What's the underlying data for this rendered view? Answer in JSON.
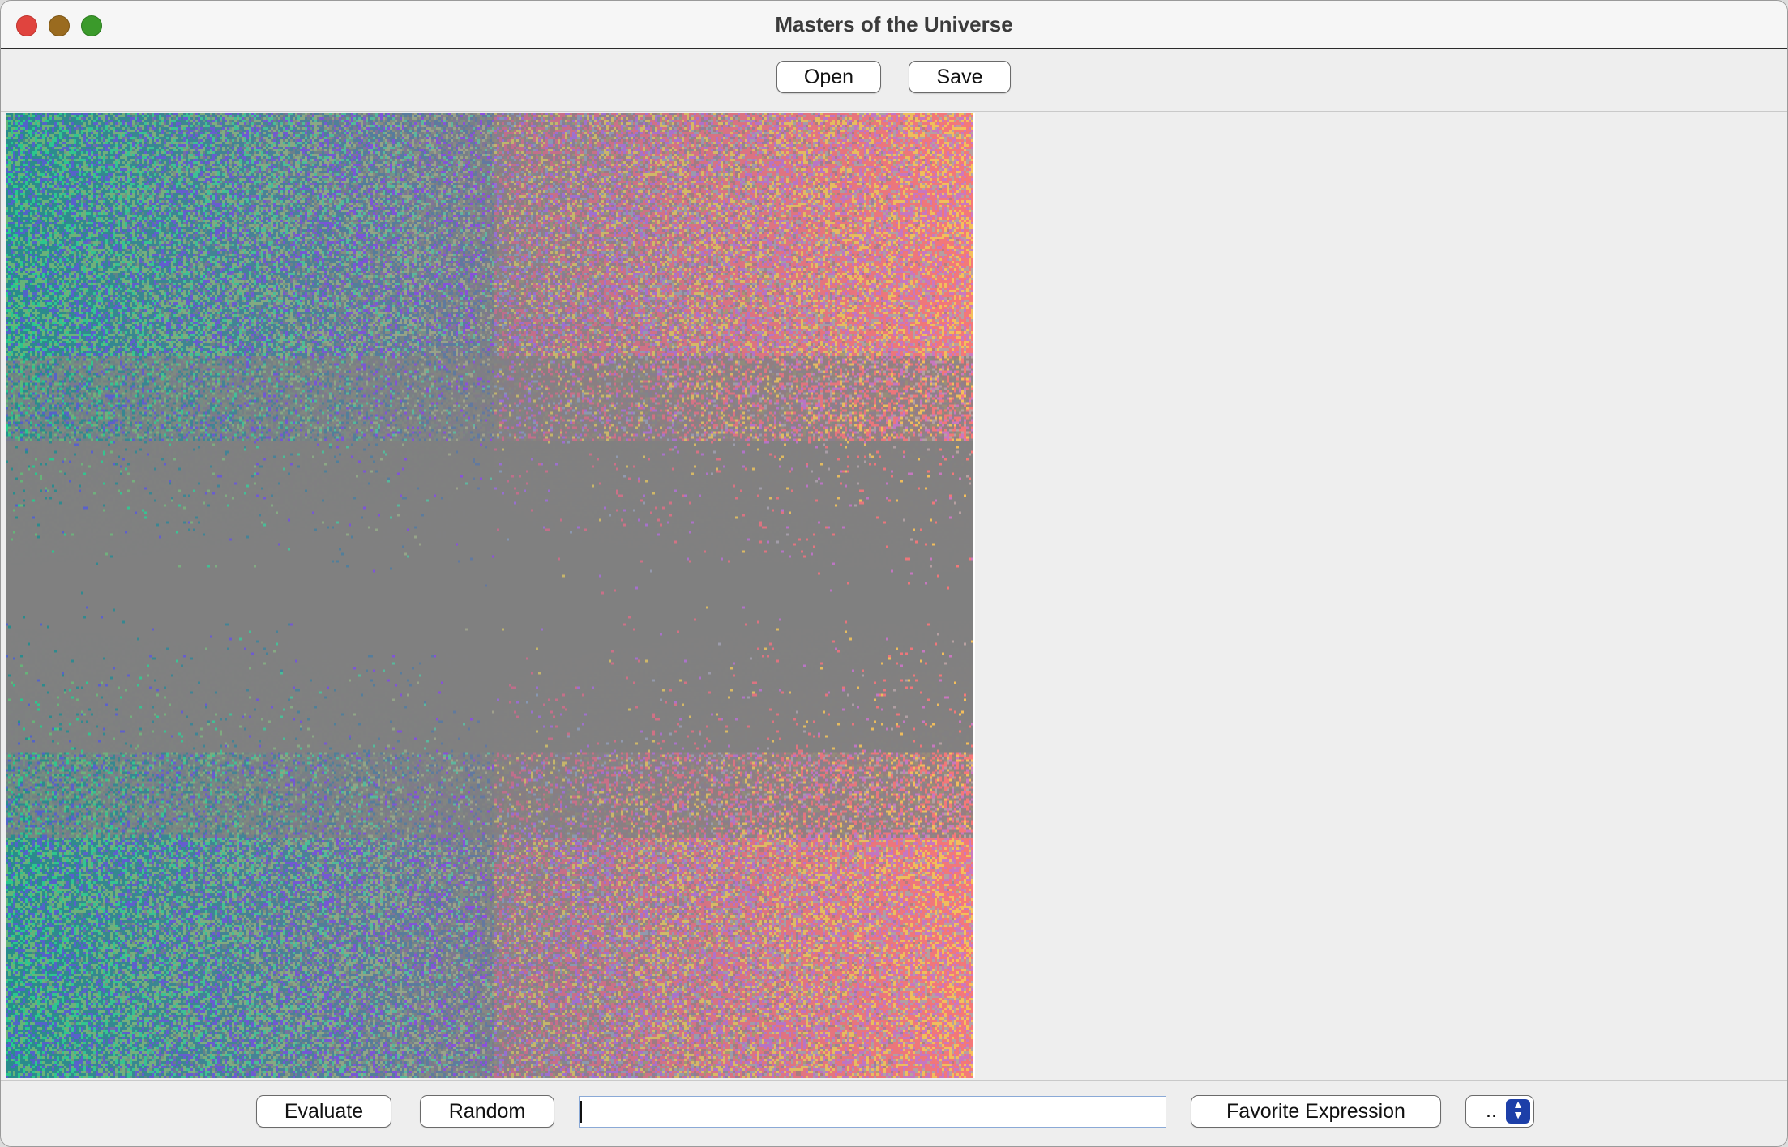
{
  "window": {
    "title": "Masters of the Universe"
  },
  "toolbar": {
    "open_label": "Open",
    "save_label": "Save"
  },
  "bottombar": {
    "evaluate_label": "Evaluate",
    "random_label": "Random",
    "expression_value": "",
    "favorite_label": "Favorite Expression",
    "select_value": ".."
  },
  "colors": {
    "close": "#e0443e",
    "minimize": "#9a6b1f",
    "maximize": "#3b9a2b",
    "select_accent": "#1d3fa8"
  },
  "icons": {
    "select_arrows": "chevron-up-down-icon"
  }
}
